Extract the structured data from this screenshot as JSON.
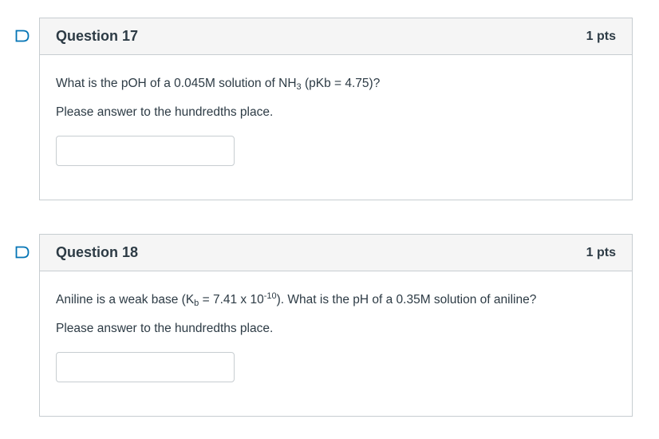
{
  "questions": [
    {
      "title": "Question 17",
      "points": "1 pts",
      "prompt": {
        "pre": "What is the pOH of a 0.045M solution of NH",
        "sub": "3",
        "post": " (pKb = 4.75)?"
      },
      "instruction": "Please answer to the hundredths place.",
      "answer_value": ""
    },
    {
      "title": "Question 18",
      "points": "1 pts",
      "prompt": {
        "pre": "Aniline is a weak base (K",
        "sub": "b",
        "mid": " = 7.41 x 10",
        "sup": "-10",
        "post": "). What is the pH of a 0.35M solution of aniline?"
      },
      "instruction": "Please answer to the hundredths place.",
      "answer_value": ""
    }
  ],
  "colors": {
    "flag": "#0374b5",
    "border": "#c7cdd1",
    "header_bg": "#f5f5f5",
    "text": "#2d3b45"
  }
}
